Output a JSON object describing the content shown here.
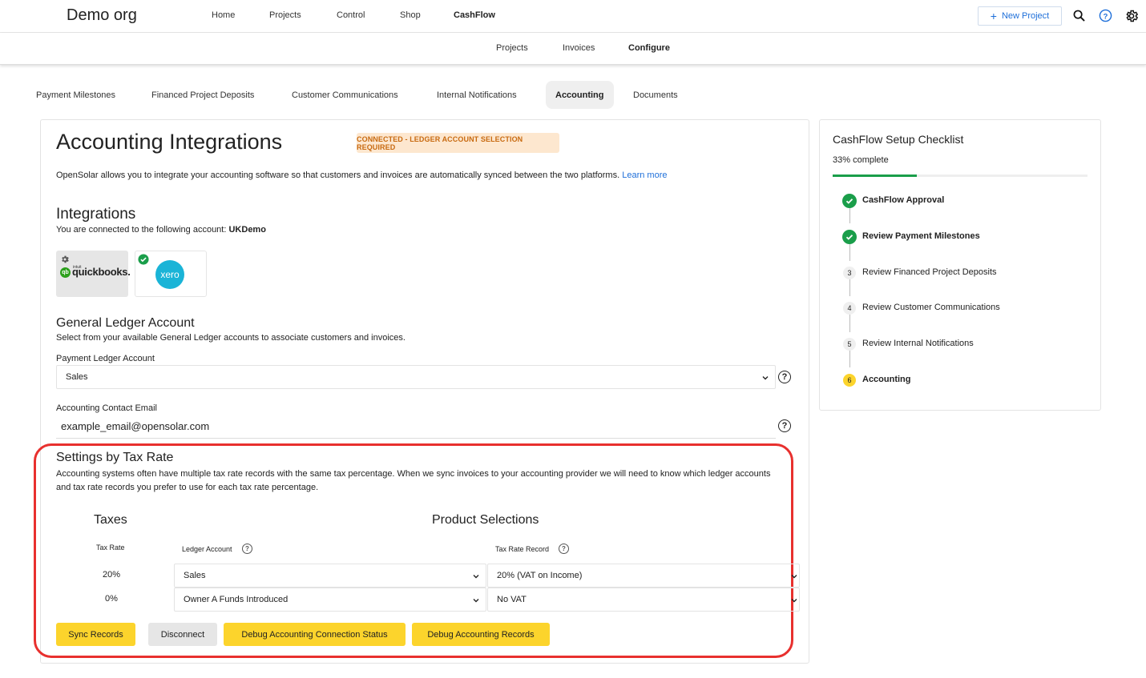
{
  "header": {
    "org_name": "Demo org",
    "nav": [
      "Home",
      "Projects",
      "Control",
      "Shop",
      "CashFlow"
    ],
    "new_project_label": "New Project",
    "icons": [
      "search-icon",
      "help-circle-icon",
      "gear-icon"
    ]
  },
  "subnav": [
    "Projects",
    "Invoices",
    "Configure"
  ],
  "tabs": [
    "Payment Milestones",
    "Financed Project Deposits",
    "Customer Communications",
    "Internal Notifications",
    "Accounting",
    "Documents"
  ],
  "main": {
    "title": "Accounting Integrations",
    "status_badge": "CONNECTED - LEDGER ACCOUNT SELECTION REQUIRED",
    "intro": "OpenSolar allows you to integrate your accounting software so that customers and invoices are automatically synced between the two platforms.",
    "learn_more": "Learn more",
    "integrations": {
      "title": "Integrations",
      "connected_text": "You are connected to the following account:",
      "account_name": "UKDemo",
      "quickbooks_intuit": "intuit",
      "quickbooks_label": "quickbooks.",
      "xero_label": "xero"
    },
    "general_ledger": {
      "title": "General Ledger Account",
      "description": "Select from your available General Ledger accounts to associate customers and invoices.",
      "payment_ledger_label": "Payment Ledger Account",
      "payment_ledger_value": "Sales",
      "contact_email_label": "Accounting Contact Email",
      "contact_email_value": "example_email@opensolar.com"
    },
    "tax_settings": {
      "title": "Settings by Tax Rate",
      "description": "Accounting systems often have multiple tax rate records with the same tax percentage. When we sync invoices to your accounting provider we will need to know which ledger accounts and tax rate records you prefer to use for each tax rate percentage.",
      "taxes_heading": "Taxes",
      "product_heading": "Product Selections",
      "col_tax_rate": "Tax Rate",
      "col_ledger": "Ledger Account",
      "col_tax_record": "Tax Rate Record",
      "rows": [
        {
          "rate": "20%",
          "ledger": "Sales",
          "record": "20% (VAT on Income)"
        },
        {
          "rate": "0%",
          "ledger": "Owner A Funds Introduced",
          "record": "No VAT"
        }
      ]
    },
    "buttons": {
      "sync": "Sync Records",
      "disconnect": "Disconnect",
      "debug_status": "Debug Accounting Connection Status",
      "debug_records": "Debug Accounting Records"
    }
  },
  "checklist": {
    "title": "CashFlow Setup Checklist",
    "progress_label": "33% complete",
    "progress": 0.33,
    "steps": [
      {
        "num": "",
        "label": "CashFlow Approval",
        "state": "done"
      },
      {
        "num": "",
        "label": "Review Payment Milestones",
        "state": "done"
      },
      {
        "num": "3",
        "label": "Review Financed Project Deposits",
        "state": "todo"
      },
      {
        "num": "4",
        "label": "Review Customer Communications",
        "state": "todo"
      },
      {
        "num": "5",
        "label": "Review Internal Notifications",
        "state": "todo"
      },
      {
        "num": "6",
        "label": "Accounting",
        "state": "current"
      }
    ]
  },
  "colors": {
    "accent_yellow": "#fcd42c",
    "success_green": "#1a9e4a",
    "link_blue": "#1e6fd9",
    "badge_bg": "#fde7cf",
    "badge_text": "#c86a10",
    "highlight_red": "#e8302e"
  }
}
